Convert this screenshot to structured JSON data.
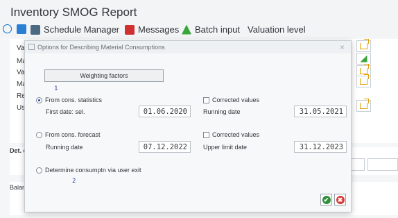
{
  "app": {
    "title": "Inventory SMOG Report"
  },
  "toolbar": {
    "schedule_manager": "Schedule Manager",
    "messages": "Messages",
    "batch_input": "Batch input",
    "valuation_level": "Valuation level"
  },
  "background": {
    "row_labels": [
      "Va",
      "Ma",
      "Va",
      "Ma",
      "Re",
      "Us"
    ],
    "tab_label": "Det. c",
    "section_label": "Balan"
  },
  "dialog": {
    "title": "Options for Describing Material Consumptions",
    "close": "×",
    "weighting_button": "Weighting factors",
    "marker_1": "1",
    "marker_2": "2",
    "from_stats": "From cons. statistics",
    "first_date_label": "First date: sel.",
    "first_date_value": "01.06.2020",
    "corrected_values_1": "Corrected values",
    "running_date_label_1": "Running date",
    "running_date_value_1": "31.05.2021",
    "from_forecast": "From cons. forecast",
    "running_date_label_2": "Running date",
    "running_date_value_2": "07.12.2022",
    "corrected_values_2": "Corrected values",
    "upper_limit_label": "Upper limit date",
    "upper_limit_value": "31.12.2023",
    "user_exit": "Determine consumptn via user exit",
    "ok": "✔",
    "cancel": "✖"
  },
  "colors": {
    "accent": "#2b3fb7",
    "ok": "#2f8f3a",
    "cancel": "#d83b3b"
  }
}
